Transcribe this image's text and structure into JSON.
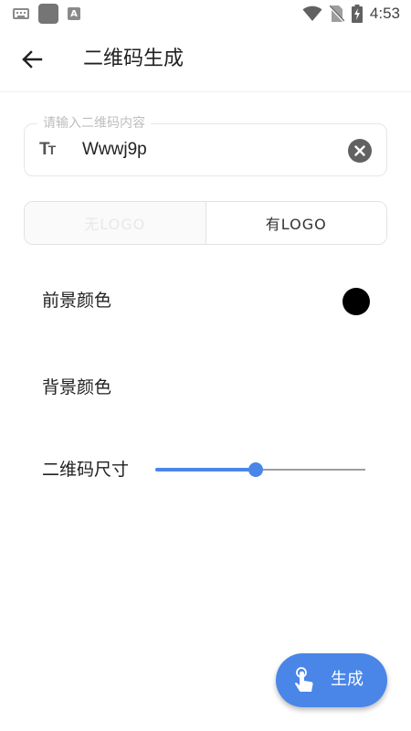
{
  "status_bar": {
    "time": "4:53"
  },
  "app_bar": {
    "title": "二维码生成"
  },
  "input": {
    "label": "请输入二维码内容",
    "value": "Wwwj9p"
  },
  "logo_toggle": {
    "options": [
      "无LOGO",
      "有LOGO"
    ],
    "selected": "有LOGO"
  },
  "settings": {
    "foreground_label": "前景颜色",
    "foreground_color": "#000000",
    "background_label": "背景颜色",
    "size_label": "二维码尺寸",
    "size_value_fraction": 0.48
  },
  "fab": {
    "label": "生成",
    "color": "#4a86e8"
  }
}
